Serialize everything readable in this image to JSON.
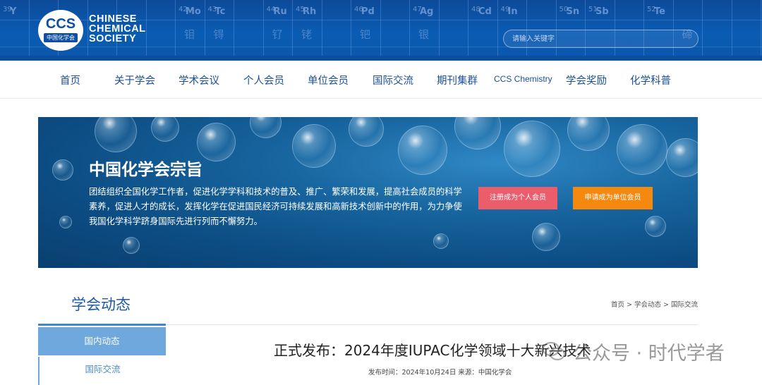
{
  "header": {
    "logo_abbr": "CCS",
    "logo_cn": "中国化学会",
    "logo_line1": "CHINESE",
    "logo_line2": "CHEMICAL",
    "logo_line3": "SOCIETY",
    "search_placeholder": "请输入关键字",
    "periodic_cells": [
      {
        "num": "39",
        "sym": "Y",
        "cn": ""
      },
      {
        "num": "",
        "sym": "",
        "cn": ""
      },
      {
        "num": "",
        "sym": "",
        "cn": ""
      },
      {
        "num": "",
        "sym": "",
        "cn": ""
      },
      {
        "num": "",
        "sym": "",
        "cn": ""
      },
      {
        "num": "",
        "sym": "",
        "cn": ""
      },
      {
        "num": "42",
        "sym": "Mo",
        "cn": "钼"
      },
      {
        "num": "43",
        "sym": "Tc",
        "cn": "锝"
      },
      {
        "num": "",
        "sym": "",
        "cn": ""
      },
      {
        "num": "44",
        "sym": "Ru",
        "cn": "钌"
      },
      {
        "num": "45",
        "sym": "Rh",
        "cn": "铑"
      },
      {
        "num": "",
        "sym": "",
        "cn": ""
      },
      {
        "num": "46",
        "sym": "Pd",
        "cn": "钯"
      },
      {
        "num": "",
        "sym": "",
        "cn": ""
      },
      {
        "num": "47",
        "sym": "Ag",
        "cn": "银"
      },
      {
        "num": "",
        "sym": "",
        "cn": ""
      },
      {
        "num": "48",
        "sym": "Cd",
        "cn": ""
      },
      {
        "num": "49",
        "sym": "In",
        "cn": ""
      },
      {
        "num": "",
        "sym": "",
        "cn": ""
      },
      {
        "num": "50",
        "sym": "Sn",
        "cn": ""
      },
      {
        "num": "51",
        "sym": "Sb",
        "cn": ""
      },
      {
        "num": "",
        "sym": "",
        "cn": ""
      },
      {
        "num": "52",
        "sym": "Te",
        "cn": ""
      },
      {
        "num": "",
        "sym": "",
        "cn": "碲"
      },
      {
        "num": "",
        "sym": "",
        "cn": ""
      },
      {
        "num": "",
        "sym": "",
        "cn": ""
      }
    ]
  },
  "nav": {
    "items": [
      "首页",
      "关于学会",
      "学术会议",
      "个人会员",
      "单位会员",
      "国际交流",
      "期刊集群",
      "CCS Chemistry",
      "学会奖励",
      "化学科普"
    ]
  },
  "banner": {
    "title": "中国化学会宗旨",
    "text": "团结组织全国化学工作者，促进化学学科和技术的普及、推广、繁荣和发展，提高社会成员的科学素养，促进人才的成长，发挥化学在促进国民经济可持续发展和高新技术创新中的作用，为力争使我国化学科学跻身国际先进行列而不懈努力。",
    "btn_individual": "注册成为个人会员",
    "btn_unit": "申请成为单位会员"
  },
  "sidebar": {
    "title": "学会动态",
    "items": [
      "国内动态",
      "国际交流"
    ]
  },
  "breadcrumb": "首页 > 学会动态 > 国际交流",
  "article": {
    "title": "正式发布：2024年度IUPAC化学领域十大新兴技术",
    "meta": "发布时间：2024年10月24日 来源：中国化学会"
  },
  "watermark": "公众号 · 时代学者",
  "colors": {
    "header_blue": "#0a5cb3",
    "nav_text": "#1b4f9b",
    "btn_red": "#ec5d6b",
    "btn_orange": "#f5880f",
    "side_active": "#6ea8dd"
  }
}
